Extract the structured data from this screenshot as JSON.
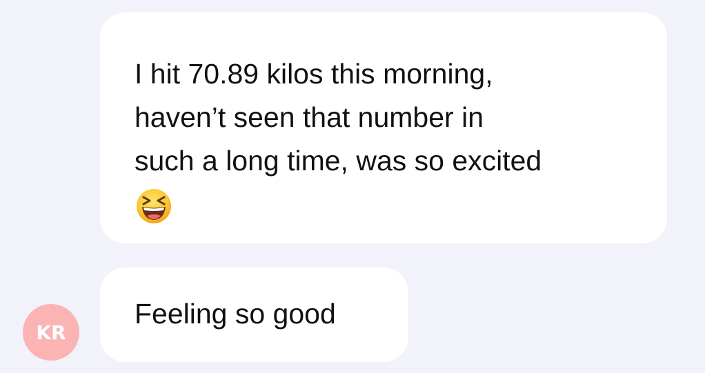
{
  "messages": [
    {
      "lines": [
        "I hit 70.89 kilos this morning,",
        "haven’t seen that number in",
        "such a long time, was so excited"
      ],
      "emoji": "grinning-squinting-face-emoji"
    },
    {
      "lines": [
        "Feeling so good"
      ]
    }
  ],
  "avatar": {
    "initials": "KR",
    "color": "#fbb3b3"
  },
  "colors": {
    "background": "#f1f2fa",
    "bubble": "#ffffff",
    "text": "#111111"
  }
}
